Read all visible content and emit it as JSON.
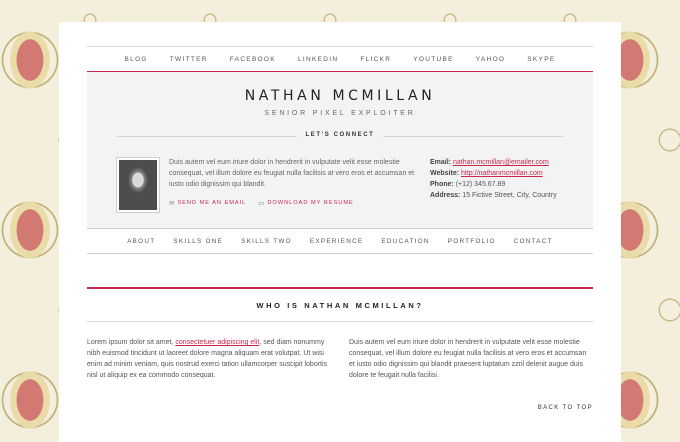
{
  "top_nav": [
    "Blog",
    "Twitter",
    "Facebook",
    "LinkedIn",
    "Flickr",
    "YouTube",
    "Yahoo",
    "Skype"
  ],
  "header": {
    "name": "NATHAN MCMILLAN",
    "subtitle": "SENIOR PIXEL EXPLOITER",
    "connect_heading": "LET'S CONNECT",
    "bio": "Duis autem vel eum iriure dolor in hendrerit in vulputate velit esse molestie consequat, vel illum dolore eu feugiat nulla facilisis at vero eros et accumsan et iusto odio dignissim qui blandit.",
    "send_email_label": "SEND ME AN EMAIL",
    "download_resume_label": "DOWNLOAD MY RESUME",
    "send_email_icon": "envelope-icon",
    "download_icon": "document-icon"
  },
  "contact": {
    "email_label": "Email:",
    "email": "nathan.mcmillan@emailer.com",
    "website_label": "Website:",
    "website": "http://nathanmcmillan.com",
    "phone_label": "Phone:",
    "phone": "(+12) 345.67.89",
    "address_label": "Address:",
    "address": "15 Fictive Street, City, Country"
  },
  "sub_nav": [
    "About",
    "Skills One",
    "Skills Two",
    "Experience",
    "Education",
    "Portfolio",
    "Contact"
  ],
  "section": {
    "title": "WHO IS NATHAN MCMILLAN?",
    "col1_before": "Lorem ipsum dolor sit amet, ",
    "col1_link": "consectetuer adipiscing elit",
    "col1_after": ", sed diam nonummy nibh euismod tincidunt ut laoreet dolore magna aliquam erat volutpat. Ut wisi enim ad minim veniam, quis nostrud exerci tation ullamcorper suscipit lobortis nisl ut aliquip ex ea commodo consequat.",
    "col2": "Duis autem vel eum iriure dolor in hendrerit in vulputate velit esse molestie consequat, vel illum dolore eu feugiat nulla facilisis at vero eros et accumsan et iusto odio dignissim qui blandit praesent luptatum zzril delenit augue duis dolore te feugait nulla facilisi."
  },
  "back_to_top": "BACK TO TOP",
  "colors": {
    "accent": "#c9284d",
    "header_bg": "#f3f3f3",
    "background": "#f4efdc"
  }
}
